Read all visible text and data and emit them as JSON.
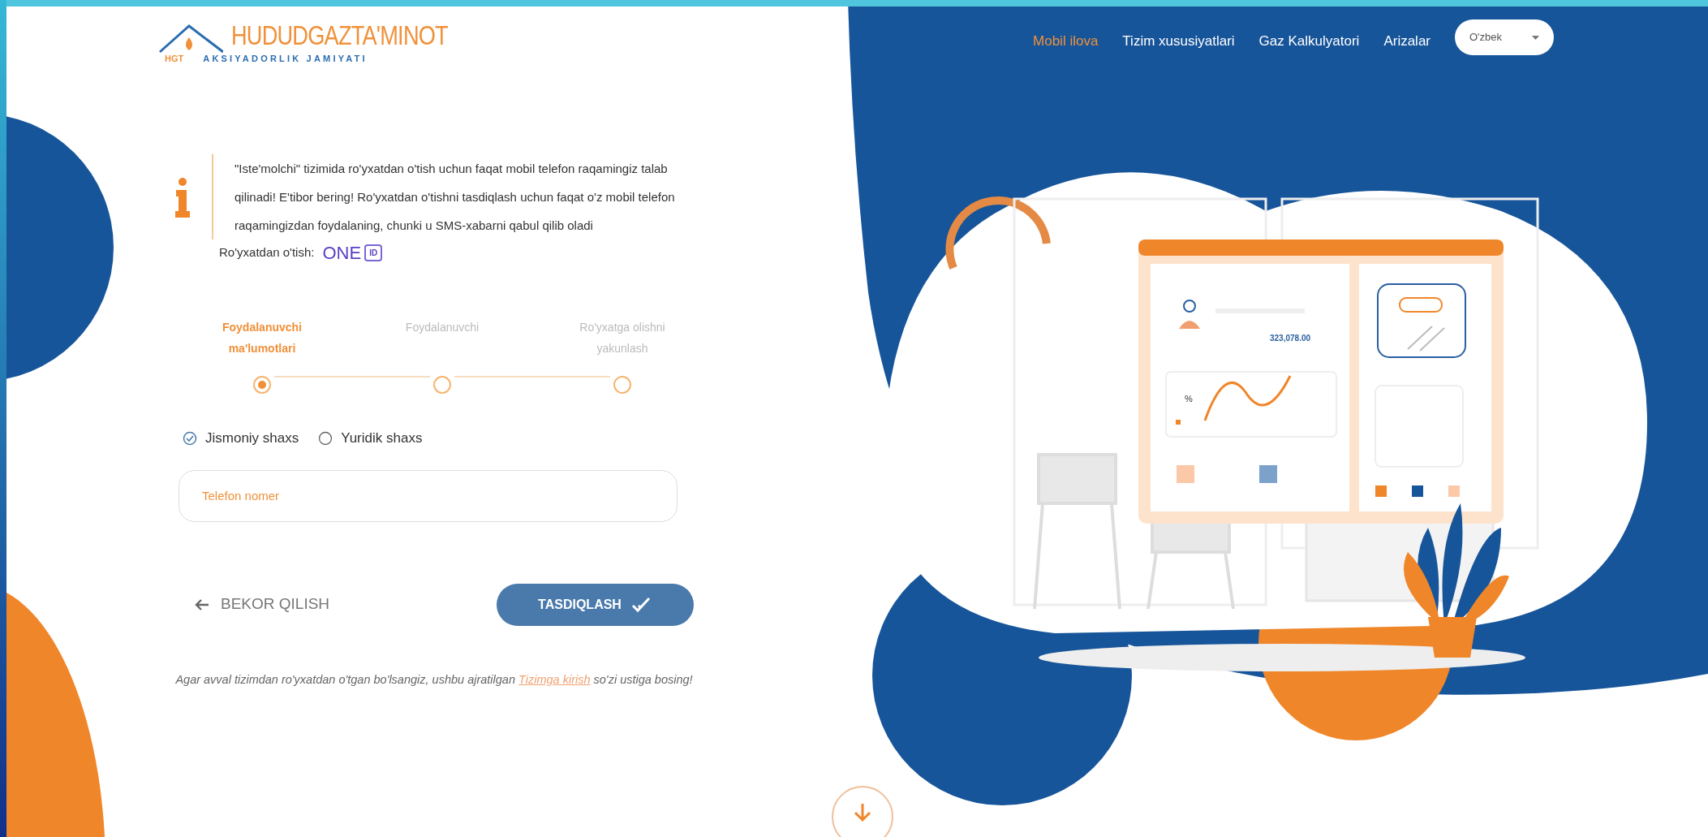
{
  "logo": {
    "title": "HUDUDGAZTA'MINOT",
    "subtitle": "AKSIYADORLIK JAMIYATI",
    "mark": "HGT"
  },
  "nav": {
    "items": [
      {
        "label": "Mobil ilova",
        "selected": true
      },
      {
        "label": "Tizim xususiyatlari",
        "selected": false
      },
      {
        "label": "Gaz Kalkulyatori",
        "selected": false
      },
      {
        "label": "Arizalar",
        "selected": false
      }
    ],
    "language": "O'zbek"
  },
  "info": {
    "text": "\"Iste'molchi\" tizimida ro'yxatdan o'tish uchun faqat mobil telefon raqamingiz talab qilinadi! E'tibor bering! Ro'yxatdan o'tishni tasdiqlash uchun faqat o'z mobil telefon raqamingizdan foydalaning, chunki u SMS-xabarni qabul qilib oladi",
    "register_label": "Ro'yxatdan o'tish:",
    "register_logo": "ONE",
    "register_badge": "ID"
  },
  "steps": [
    {
      "label": "Foydalanuvchi ma'lumotlari",
      "selected": true
    },
    {
      "label": "Foydalanuvchi",
      "selected": false
    },
    {
      "label": "Ro'yxatga olishni yakunlash",
      "selected": false
    }
  ],
  "person_types": [
    {
      "label": "Jismoniy shaxs",
      "selected": true
    },
    {
      "label": "Yuridik shaxs",
      "selected": false
    }
  ],
  "phone_field": {
    "placeholder": "Telefon nomer"
  },
  "cancel_button": "BEKOR QILISH",
  "confirm_button": "TASDIQLASH",
  "footer_note": {
    "before": "Agar avval tizimdan ro'yxatdan o'tgan bo'lsangiz, ushbu ajratilgan ",
    "link": "Tizimga kirish",
    "after": " so'zi ustiga bosing!"
  },
  "illustration": {
    "amount": "323,078.00",
    "percent": "%"
  }
}
